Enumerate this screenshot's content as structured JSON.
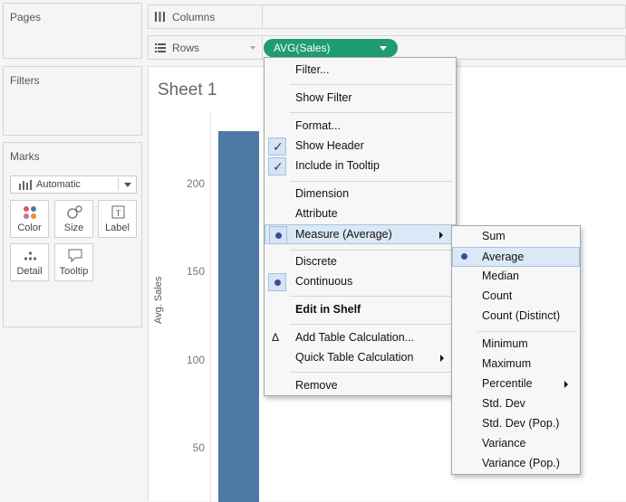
{
  "left_panels": {
    "pages_title": "Pages",
    "filters_title": "Filters",
    "marks_title": "Marks",
    "mark_type": "Automatic",
    "mark_buttons": {
      "color": "Color",
      "size": "Size",
      "label": "Label",
      "detail": "Detail",
      "tooltip": "Tooltip"
    }
  },
  "shelves": {
    "columns_label": "Columns",
    "rows_label": "Rows",
    "rows_pill": "AVG(Sales)",
    "pill_color": "#1e9e6e"
  },
  "sheet": {
    "title": "Sheet 1",
    "chart_data": {
      "type": "bar",
      "ylabel": "Avg. Sales",
      "ytick_labels": [
        "200",
        "150",
        "100",
        "50"
      ],
      "bar_color": "#4e79a7",
      "values": [
        230
      ],
      "ylim": [
        0,
        240
      ]
    }
  },
  "context_menu": {
    "filter": "Filter...",
    "show_filter": "Show Filter",
    "format": "Format...",
    "show_header": "Show Header",
    "include_tooltip": "Include in Tooltip",
    "dimension": "Dimension",
    "attribute": "Attribute",
    "measure": "Measure (Average)",
    "discrete": "Discrete",
    "continuous": "Continuous",
    "edit_in_shelf": "Edit in Shelf",
    "add_table_calc": "Add Table Calculation...",
    "quick_table_calc": "Quick Table Calculation",
    "remove": "Remove"
  },
  "measure_submenu": {
    "sum": "Sum",
    "average": "Average",
    "median": "Median",
    "count": "Count",
    "count_distinct": "Count (Distinct)",
    "minimum": "Minimum",
    "maximum": "Maximum",
    "percentile": "Percentile",
    "std_dev": "Std. Dev",
    "std_dev_pop": "Std. Dev (Pop.)",
    "variance": "Variance",
    "variance_pop": "Variance (Pop.)"
  }
}
